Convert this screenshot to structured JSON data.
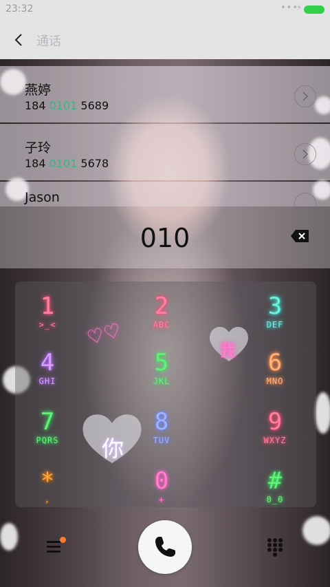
{
  "status_bar": {
    "time": "23:32",
    "dots": "•••",
    "charging": "⚡"
  },
  "header": {
    "title": "通话"
  },
  "contacts": [
    {
      "name": "燕婷",
      "number_pre": "184 ",
      "number_hl": "0101",
      "number_post": " 5689"
    },
    {
      "name": "子玲",
      "number_pre": "184 ",
      "number_hl": "0101",
      "number_post": " 5678"
    },
    {
      "name": "Jason",
      "number_pre": "",
      "number_hl": "",
      "number_post": ""
    }
  ],
  "dialed_number": "010",
  "keypad": [
    {
      "digit": "1",
      "letters": ">_<"
    },
    {
      "digit": "2",
      "letters": "ABC"
    },
    {
      "digit": "3",
      "letters": "DEF"
    },
    {
      "digit": "4",
      "letters": "GHI"
    },
    {
      "digit": "5",
      "letters": "JKL"
    },
    {
      "digit": "6",
      "letters": "MNO"
    },
    {
      "digit": "7",
      "letters": "PQRS"
    },
    {
      "digit": "8",
      "letters": "TUV"
    },
    {
      "digit": "9",
      "letters": "WXYZ"
    },
    {
      "digit": "*",
      "letters": ","
    },
    {
      "digit": "0",
      "letters": "+"
    },
    {
      "digit": "#",
      "letters": "0_0"
    }
  ],
  "decorations": {
    "heart_left": "♡♡",
    "heart_char_1": "你",
    "heart_char_2": "我"
  },
  "icons": {
    "back": "chevron-left-icon",
    "contact_detail": "chevron-right-icon",
    "backspace": "backspace-icon",
    "menu": "hamburger-icon",
    "call": "phone-icon",
    "keypad": "dialpad-icon"
  },
  "colors": {
    "accent_green": "#38b48a",
    "battery": "#35d04a",
    "notification_dot": "#ff7a2a"
  }
}
